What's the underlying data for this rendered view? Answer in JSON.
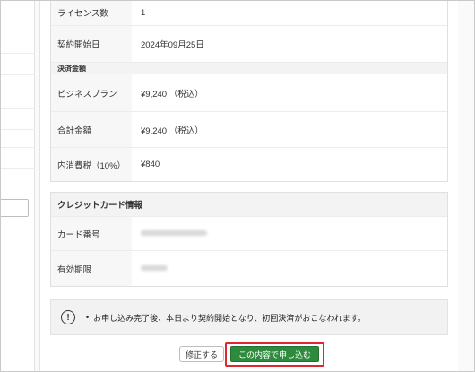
{
  "contract": {
    "rows": [
      {
        "label": "ライセンス数",
        "value": "1"
      },
      {
        "label": "契約開始日",
        "value": "2024年09月25日"
      }
    ]
  },
  "payment": {
    "section_label": "決済金額",
    "rows": [
      {
        "label": "ビジネスプラン",
        "value": "¥9,240 （税込）"
      },
      {
        "label": "合計金額",
        "value": "¥9,240 （税込）"
      },
      {
        "label": "内消費税（10%）",
        "value": "¥840"
      }
    ]
  },
  "credit_card": {
    "title": "クレジットカード情報",
    "rows": [
      {
        "label": "カード番号"
      },
      {
        "label": "有効期限"
      }
    ]
  },
  "notice": {
    "icon": "exclamation-icon",
    "bullet": "•",
    "text": "お申し込み完了後、本日より契約開始となり、初回決済がおこなわれます。"
  },
  "actions": {
    "edit_label": "修正する",
    "submit_label": "この内容で申し込む"
  },
  "colors": {
    "submit": "#2e8b3e",
    "highlight": "#e0262f"
  }
}
